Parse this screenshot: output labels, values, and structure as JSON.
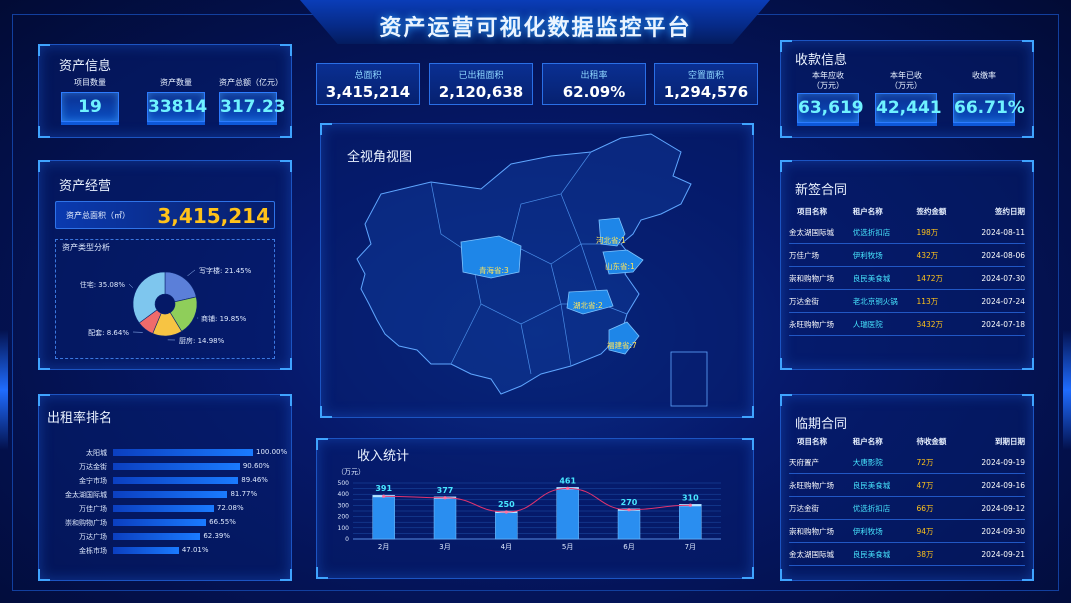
{
  "header": {
    "title": "资产运营可视化数据监控平台"
  },
  "top_stats": [
    {
      "label": "总面积",
      "value": "3,415,214"
    },
    {
      "label": "已出租面积",
      "value": "2,120,638"
    },
    {
      "label": "出租率",
      "value": "62.09%"
    },
    {
      "label": "空置面积",
      "value": "1,294,576"
    }
  ],
  "asset_info": {
    "title": "资产信息",
    "items": [
      {
        "label": "项目数量",
        "value": "19"
      },
      {
        "label": "资产数量",
        "value": "33814"
      },
      {
        "label": "资产总额（亿元）",
        "value": "317.23"
      }
    ]
  },
  "asset_ops": {
    "title": "资产经营",
    "total_label": "资产总面积（㎡）",
    "total_value": "3,415,214",
    "type_title": "资产类型分析",
    "pie": [
      {
        "name": "写字楼",
        "label": "写字楼: 21.45%",
        "value": 21.45,
        "color": "#5b7fd9"
      },
      {
        "name": "商铺",
        "label": "商铺: 19.85%",
        "value": 19.85,
        "color": "#8fce5a"
      },
      {
        "name": "厨房",
        "label": "厨房: 14.98%",
        "value": 14.98,
        "color": "#f7c443"
      },
      {
        "name": "配套",
        "label": "配套: 8.64%",
        "value": 8.64,
        "color": "#f06b6b"
      },
      {
        "name": "住宅",
        "label": "住宅: 35.08%",
        "value": 35.08,
        "color": "#7ec6ee"
      }
    ]
  },
  "rank": {
    "title": "出租率排名",
    "items": [
      {
        "name": "太阳城",
        "value": 100.0,
        "label": "100.00%"
      },
      {
        "name": "万达金街",
        "value": 90.6,
        "label": "90.60%"
      },
      {
        "name": "金宁市场",
        "value": 89.46,
        "label": "89.46%"
      },
      {
        "name": "金太湖国际城",
        "value": 81.77,
        "label": "81.77%"
      },
      {
        "name": "万佳广场",
        "value": 72.08,
        "label": "72.08%"
      },
      {
        "name": "崇和购物广场",
        "value": 66.55,
        "label": "66.55%"
      },
      {
        "name": "万达广场",
        "value": 62.39,
        "label": "62.39%"
      },
      {
        "name": "金栎市场",
        "value": 47.01,
        "label": "47.01%"
      }
    ]
  },
  "map": {
    "title": "全视角视图",
    "labels": [
      "青海省:3",
      "河北省:1",
      "山东省:1",
      "湖北省:2",
      "福建省:7"
    ]
  },
  "income": {
    "title": "收入统计",
    "unit": "（万元）",
    "chart_data": {
      "type": "bar",
      "categories": [
        "2月",
        "3月",
        "4月",
        "5月",
        "6月",
        "7月"
      ],
      "values": [
        391,
        377,
        250,
        461,
        270,
        310
      ],
      "ylim": [
        0,
        500
      ],
      "yticks": [
        0,
        50,
        100,
        150,
        200,
        250,
        300,
        350,
        400,
        450,
        500
      ],
      "grid": true
    }
  },
  "collection": {
    "title": "收款信息",
    "items": [
      {
        "label1": "本年应收",
        "label2": "（万元）",
        "value": "63,619"
      },
      {
        "label1": "本年已收",
        "label2": "（万元）",
        "value": "42,441"
      },
      {
        "label1": "收缴率",
        "label2": "",
        "value": "66.71%"
      }
    ]
  },
  "new_contracts": {
    "title": "新签合同",
    "headers": [
      "项目名称",
      "租户名称",
      "签约金额",
      "签约日期"
    ],
    "rows": [
      [
        "金太湖国际城",
        "优选折扣店",
        "198万",
        "2024-08-11"
      ],
      [
        "万佳广场",
        "伊利牧场",
        "432万",
        "2024-08-06"
      ],
      [
        "崇和购物广场",
        "良民美食城",
        "1472万",
        "2024-07-30"
      ],
      [
        "万达金街",
        "老北京铜火锅",
        "113万",
        "2024-07-24"
      ],
      [
        "永旺购物广场",
        "人瑞医院",
        "3432万",
        "2024-07-18"
      ]
    ]
  },
  "expiring": {
    "title": "临期合同",
    "headers": [
      "项目名称",
      "租户名称",
      "待收金额",
      "到期日期"
    ],
    "rows": [
      [
        "天府置产",
        "大唐影院",
        "72万",
        "2024-09-19"
      ],
      [
        "永旺购物广场",
        "良民美食城",
        "47万",
        "2024-09-16"
      ],
      [
        "万达金街",
        "优选折扣店",
        "66万",
        "2024-09-12"
      ],
      [
        "崇和购物广场",
        "伊利牧场",
        "94万",
        "2024-09-30"
      ],
      [
        "金太湖国际城",
        "良民美食城",
        "38万",
        "2024-09-21"
      ]
    ]
  }
}
